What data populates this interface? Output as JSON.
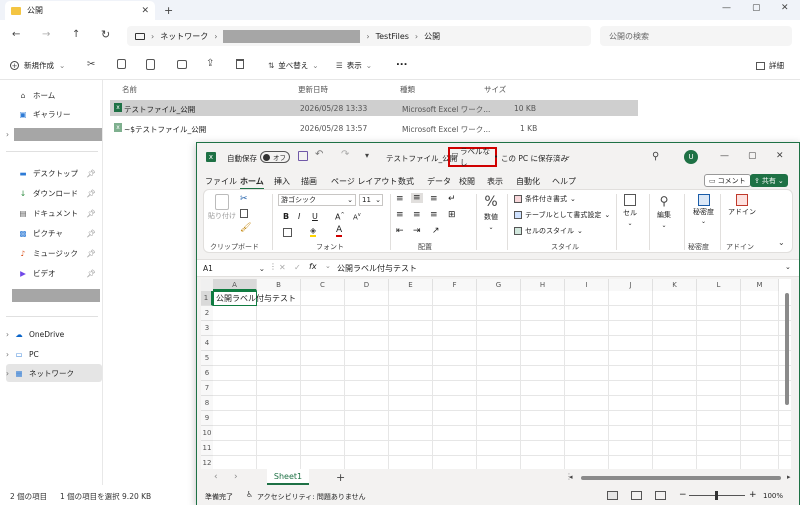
{
  "explorer": {
    "tab_title": "公開",
    "breadcrumb": [
      "ネットワーク",
      "TestFiles",
      "公開"
    ],
    "search_placeholder": "公開の検索",
    "toolbar": {
      "new": "新規作成",
      "sort": "並べ替え",
      "view": "表示",
      "more": "...",
      "details": "詳細"
    },
    "nav": {
      "home": "ホーム",
      "gallery": "ギャラリー",
      "desktop": "デスクトップ",
      "downloads": "ダウンロード",
      "documents": "ドキュメント",
      "pictures": "ピクチャ",
      "music": "ミュージック",
      "videos": "ビデオ",
      "onedrive": "OneDrive",
      "pc": "PC",
      "network": "ネットワーク"
    },
    "columns": [
      "名前",
      "更新日時",
      "種類",
      "サイズ"
    ],
    "files": [
      {
        "name": "テストファイル_公開",
        "date": "2026/05/28 13:33",
        "type": "Microsoft Excel ワーク...",
        "size": "10 KB"
      },
      {
        "name": "~$テストファイル_公開",
        "date": "2026/05/28 13:57",
        "type": "Microsoft Excel ワーク...",
        "size": "1 KB"
      }
    ],
    "status": {
      "count": "2 個の項目",
      "selected": "1 個の項目を選択 9.20 KB"
    }
  },
  "excel": {
    "autosave": "自動保存",
    "autosave_state": "オフ",
    "filename": "テストファイル_公開",
    "label": "ラベルなし",
    "saved": "この PC に保存済み",
    "user_initial": "U",
    "menu": [
      "ファイル",
      "ホーム",
      "挿入",
      "描画",
      "ページ レイアウト",
      "数式",
      "データ",
      "校閲",
      "表示",
      "自動化",
      "ヘルプ"
    ],
    "comment": "コメント",
    "share": "共有",
    "ribbon": {
      "paste": "貼り付け",
      "clipboard": "クリップボード",
      "font_name": "游ゴシック",
      "font_size": "11",
      "font": "フォント",
      "alignment": "配置",
      "number": "数値",
      "cond_format": "条件付き書式",
      "table_format": "テーブルとして書式設定",
      "cell_styles": "セルのスタイル",
      "styles": "スタイル",
      "cells": "セル",
      "editing": "編集",
      "sensitivity": "秘密度",
      "sensitivity_group": "秘密度",
      "addins": "アドイン",
      "addins_group": "アドイン"
    },
    "namebox": "A1",
    "formula": "公開ラベル付与テスト",
    "col_headers": [
      "A",
      "B",
      "C",
      "D",
      "E",
      "F",
      "G",
      "H",
      "I",
      "J",
      "K",
      "L",
      "M"
    ],
    "row_headers": [
      "1",
      "2",
      "3",
      "4",
      "5",
      "6",
      "7",
      "8",
      "9",
      "10",
      "11",
      "12"
    ],
    "a1": "公開ラベル付与テスト",
    "sheet": "Sheet1",
    "status_ready": "準備完了",
    "accessibility": "アクセシビリティ: 問題ありません",
    "zoom": "100%"
  },
  "colors": {
    "excel_green": "#1e7145",
    "label_box": "#d00000"
  }
}
